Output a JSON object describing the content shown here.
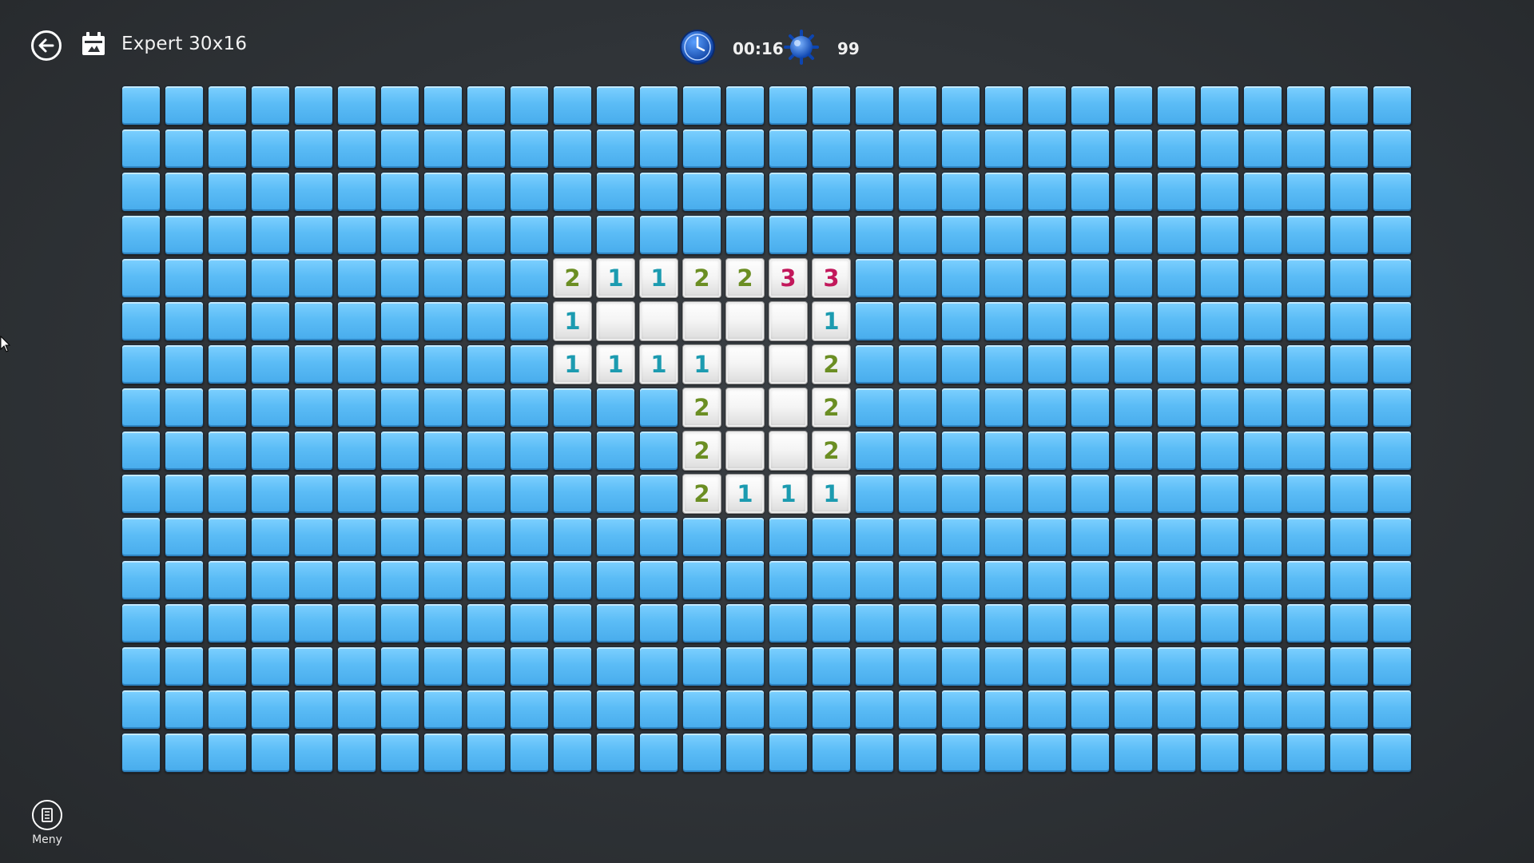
{
  "header": {
    "back_icon": "arrow-left-icon",
    "calendar_icon": "calendar-icon",
    "title": "Expert 30x16",
    "timer_icon": "clock-icon",
    "timer": "00:16",
    "mine_icon": "mine-icon",
    "mines_remaining": "99"
  },
  "board": {
    "columns": 30,
    "rows": 16,
    "hidden_color": "#5bbcf6",
    "revealed_color": "#f4f4f4",
    "number_colors": {
      "1": "#1c9bb0",
      "2": "#6b8e23",
      "3": "#c2185b"
    },
    "revealed": [
      {
        "row": 4,
        "col": 10,
        "value": "2"
      },
      {
        "row": 4,
        "col": 11,
        "value": "1"
      },
      {
        "row": 4,
        "col": 12,
        "value": "1"
      },
      {
        "row": 4,
        "col": 13,
        "value": "2"
      },
      {
        "row": 4,
        "col": 14,
        "value": "2"
      },
      {
        "row": 4,
        "col": 15,
        "value": "3"
      },
      {
        "row": 4,
        "col": 16,
        "value": "3"
      },
      {
        "row": 5,
        "col": 10,
        "value": "1"
      },
      {
        "row": 5,
        "col": 11,
        "value": ""
      },
      {
        "row": 5,
        "col": 12,
        "value": ""
      },
      {
        "row": 5,
        "col": 13,
        "value": ""
      },
      {
        "row": 5,
        "col": 14,
        "value": ""
      },
      {
        "row": 5,
        "col": 15,
        "value": ""
      },
      {
        "row": 5,
        "col": 16,
        "value": "1"
      },
      {
        "row": 6,
        "col": 10,
        "value": "1"
      },
      {
        "row": 6,
        "col": 11,
        "value": "1"
      },
      {
        "row": 6,
        "col": 12,
        "value": "1"
      },
      {
        "row": 6,
        "col": 13,
        "value": "1"
      },
      {
        "row": 6,
        "col": 14,
        "value": ""
      },
      {
        "row": 6,
        "col": 15,
        "value": ""
      },
      {
        "row": 6,
        "col": 16,
        "value": "2"
      },
      {
        "row": 7,
        "col": 13,
        "value": "2"
      },
      {
        "row": 7,
        "col": 14,
        "value": ""
      },
      {
        "row": 7,
        "col": 15,
        "value": ""
      },
      {
        "row": 7,
        "col": 16,
        "value": "2"
      },
      {
        "row": 8,
        "col": 13,
        "value": "2"
      },
      {
        "row": 8,
        "col": 14,
        "value": ""
      },
      {
        "row": 8,
        "col": 15,
        "value": ""
      },
      {
        "row": 8,
        "col": 16,
        "value": "2"
      },
      {
        "row": 9,
        "col": 13,
        "value": "2"
      },
      {
        "row": 9,
        "col": 14,
        "value": "1"
      },
      {
        "row": 9,
        "col": 15,
        "value": "1"
      },
      {
        "row": 9,
        "col": 16,
        "value": "1"
      }
    ]
  },
  "footer": {
    "menu_icon": "menu-icon",
    "menu_label": "Meny"
  }
}
